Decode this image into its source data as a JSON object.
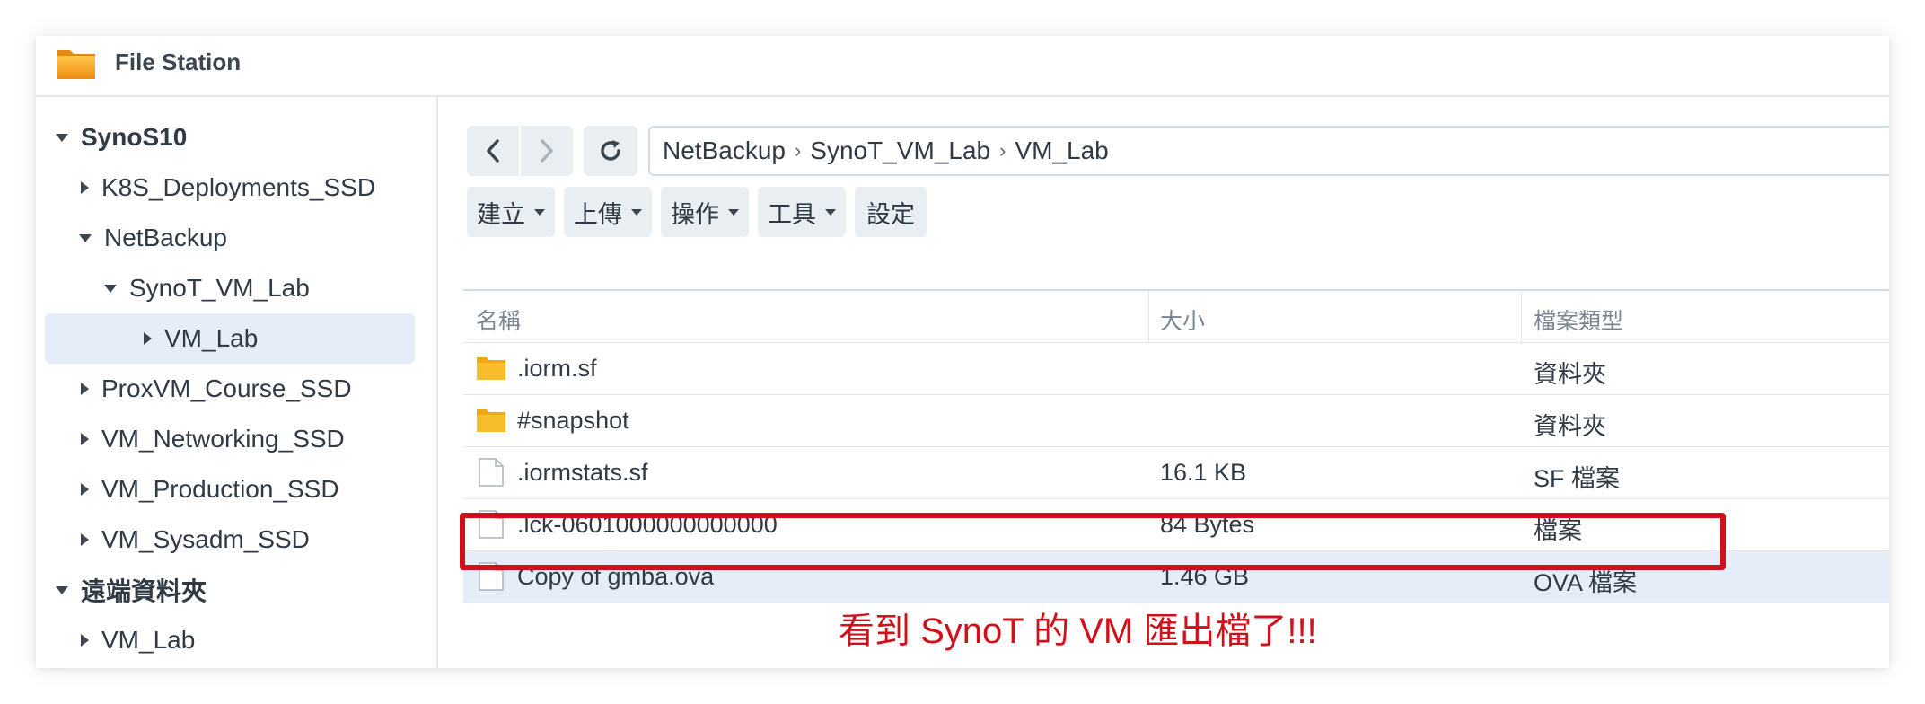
{
  "app": {
    "title": "File Station",
    "icon": "folder-app-icon",
    "accent_color": "#f4a81c"
  },
  "sidebar": {
    "items": [
      {
        "label": "SynoS10",
        "expanded": true,
        "root": true
      },
      {
        "label": "K8S_Deployments_SSD",
        "expanded": false
      },
      {
        "label": "NetBackup",
        "expanded": true
      },
      {
        "label": "SynoT_VM_Lab",
        "expanded": true
      },
      {
        "label": "VM_Lab",
        "expanded": false,
        "selected": true
      },
      {
        "label": "ProxVM_Course_SSD",
        "expanded": false
      },
      {
        "label": "VM_Networking_SSD",
        "expanded": false
      },
      {
        "label": "VM_Production_SSD",
        "expanded": false
      },
      {
        "label": "VM_Sysadm_SSD",
        "expanded": false
      },
      {
        "label": "遠端資料夾",
        "expanded": true,
        "root": true
      },
      {
        "label": "VM_Lab",
        "expanded": false
      }
    ]
  },
  "nav": {
    "back_icon": "chevron-left-icon",
    "forward_icon": "chevron-right-icon",
    "refresh_icon": "refresh-icon"
  },
  "breadcrumb": [
    "NetBackup",
    "SynoT_VM_Lab",
    "VM_Lab"
  ],
  "toolbar": {
    "create": "建立",
    "upload": "上傳",
    "action": "操作",
    "tools": "工具",
    "settings": "設定"
  },
  "table": {
    "columns": [
      "名稱",
      "大小",
      "檔案類型"
    ],
    "rows": [
      {
        "name": ".iorm.sf",
        "size": "",
        "type": "資料夾",
        "icon": "folder-icon"
      },
      {
        "name": "#snapshot",
        "size": "",
        "type": "資料夾",
        "icon": "folder-icon"
      },
      {
        "name": ".iormstats.sf",
        "size": "16.1 KB",
        "type": "SF 檔案",
        "icon": "file-icon"
      },
      {
        "name": ".lck-0601000000000000",
        "size": "84 Bytes",
        "type": "檔案",
        "icon": "file-icon"
      },
      {
        "name": "Copy of gmba.ova",
        "size": "1.46 GB",
        "type": "OVA 檔案",
        "icon": "file-icon",
        "selected": true
      }
    ]
  },
  "annotation": {
    "text": "看到 SynoT  的 VM 匯出檔了!!!",
    "color": "#d0111b"
  }
}
